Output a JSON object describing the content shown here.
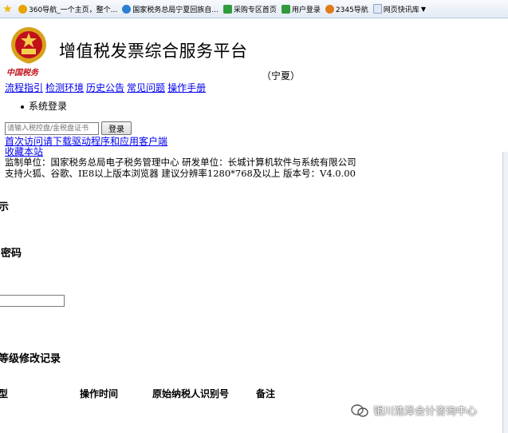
{
  "favorites": [
    {
      "icon": "star-icon",
      "label": ""
    },
    {
      "icon": "360-icon",
      "label": "360导航_一个主页，整个..."
    },
    {
      "icon": "ie-page-icon",
      "label": "国家税务总局宁夏回族自..."
    },
    {
      "icon": "g-icon",
      "label": "采购专区首页"
    },
    {
      "icon": "g-icon",
      "label": "用户登录"
    },
    {
      "icon": "tree-icon",
      "label": "2345导航"
    },
    {
      "icon": "page-icon",
      "label": "网页快讯库"
    }
  ],
  "header": {
    "emblem_text": "中国税务",
    "title": "增值税发票综合服务平台",
    "region": "（宁夏）"
  },
  "nav": [
    "流程指引",
    "检测环境",
    "历史公告",
    "常见问题",
    "操作手册"
  ],
  "login": {
    "section_label": "系统登录",
    "cert_placeholder": "请输入税控盘/金税盘证书",
    "login_button": "登录",
    "first_visit_link": "首次访问请下载驱动程序和应用客户端",
    "favorite_link": "收藏本站"
  },
  "info": {
    "line1": "监制单位：国家税务总局电子税务管理中心   研发单位：长城计算机软件与系统有限公司",
    "line2": "支持火狐、谷歌、IE8以上版本浏览器   建议分辨率1280*768及以上    版本号：V4.0.00"
  },
  "background_panel": {
    "frag_tip": "示",
    "frag_password": "密码",
    "frag_history": "等级修改记录",
    "columns": [
      "型",
      "操作时间",
      "原始纳税人识别号",
      "备注"
    ]
  },
  "watermark": "银川浩泽会计咨询中心"
}
